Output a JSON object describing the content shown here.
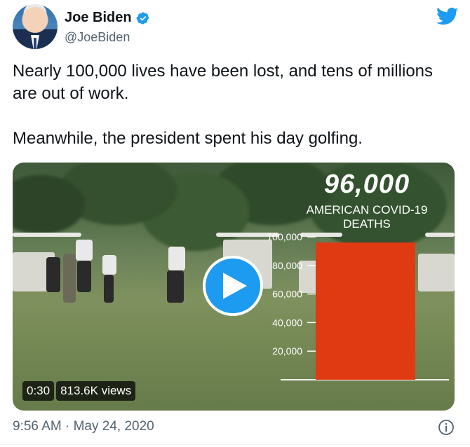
{
  "author": {
    "display_name": "Joe Biden",
    "handle": "@JoeBiden",
    "verified": true,
    "avatar_icon": "profile-photo"
  },
  "tweet": {
    "text": "Nearly 100,000 lives have been lost, and tens of millions are out of work.\n\nMeanwhile, the president spent his day golfing.",
    "timestamp": "9:56 AM · May 24, 2020"
  },
  "video": {
    "duration": "0:30",
    "views": "813.6K views",
    "overlay_title": "96,000",
    "overlay_subtitle": "AMERICAN COVID-19\nDEATHS"
  },
  "chart_data": {
    "type": "bar",
    "title": "96,000",
    "subtitle": "AMERICAN COVID-19 DEATHS",
    "categories": [
      ""
    ],
    "values": [
      96000
    ],
    "ylim": [
      0,
      100000
    ],
    "yticks": [
      20000,
      40000,
      60000,
      80000,
      100000
    ],
    "ytick_labels": [
      "20,000",
      "40,000",
      "60,000",
      "80,000",
      "100,000"
    ],
    "bar_color": "#e03a12",
    "grid": false
  },
  "colors": {
    "brand_blue": "#1d9bf0",
    "text_primary": "#0f1419",
    "text_secondary": "#536471"
  },
  "icons": {
    "verified": "verified-badge-icon",
    "platform": "twitter-bird-icon",
    "play": "play-icon",
    "info": "info-icon"
  }
}
